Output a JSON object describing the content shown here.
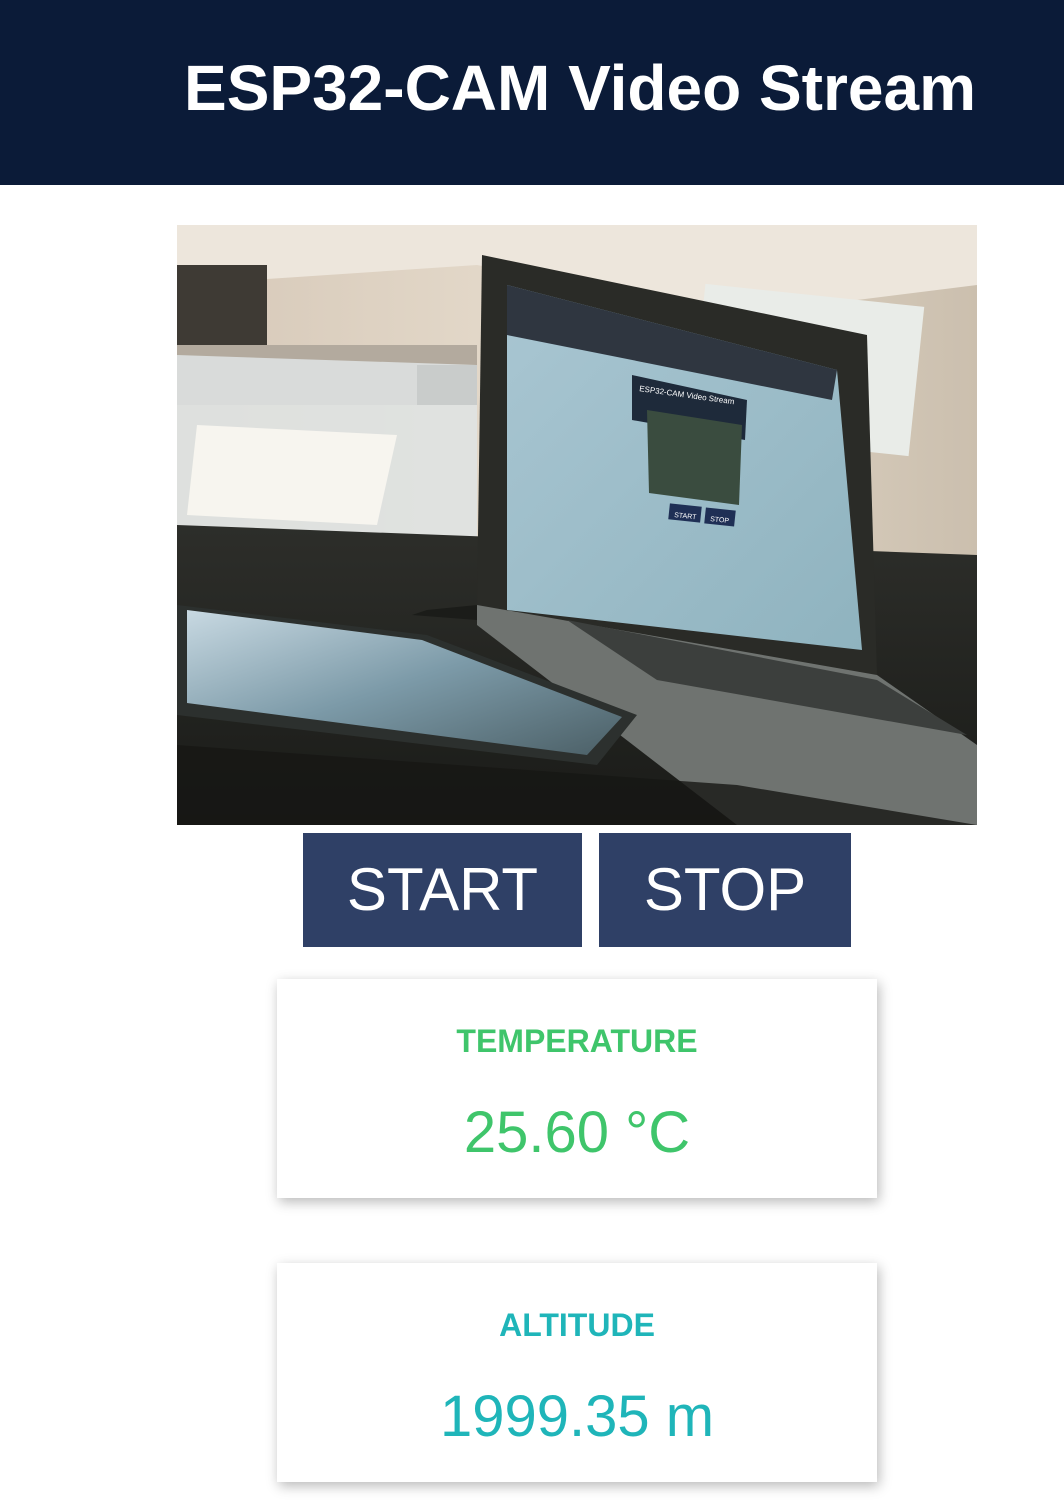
{
  "header": {
    "title": "ESP32-CAM Video Stream",
    "background_color": "#0b1b38"
  },
  "stream": {
    "laptop_screen_title": "ESP32-CAM Video Stream",
    "laptop_screen_start": "START",
    "laptop_screen_stop": "STOP"
  },
  "controls": {
    "start_label": "START",
    "stop_label": "STOP",
    "button_color": "#2f4066"
  },
  "readings": {
    "temperature": {
      "label": "TEMPERATURE",
      "value": "25.60 °C",
      "color": "#3fc56b"
    },
    "altitude": {
      "label": "ALTITUDE",
      "value": "1999.35 m",
      "color": "#1fb5b9"
    }
  }
}
